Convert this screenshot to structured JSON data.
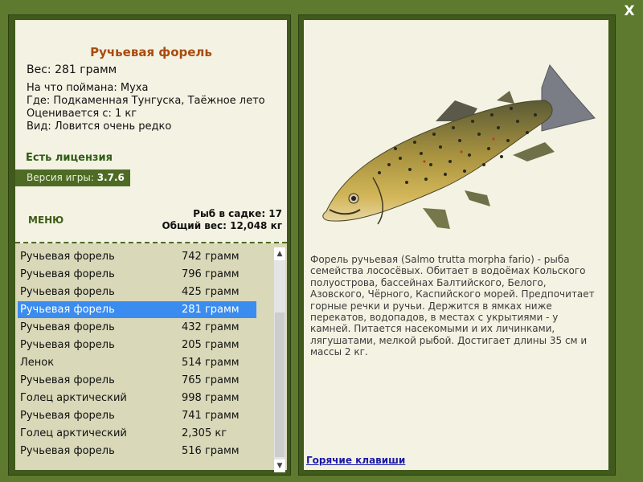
{
  "fish": {
    "title": "Ручьевая форель",
    "weight": "Вес: 281 грамм",
    "caught_on": "На что поймана: Муха",
    "location": "Где: Подкаменная Тунгуска, Таёжное лето",
    "valued_from": "Оценивается с: 1 кг",
    "rarity": "Вид: Ловится очень редко"
  },
  "license": "Есть лицензия",
  "version": {
    "label": "Версия игры: ",
    "value": "3.7.6"
  },
  "menu_label": "МЕНЮ",
  "stats": {
    "count": "Рыб в садке: 17",
    "total_weight": "Общий вес: 12,048 кг"
  },
  "catch_list": [
    {
      "name": "Ручьевая форель",
      "weight": "742 грамм"
    },
    {
      "name": "Ручьевая форель",
      "weight": "796 грамм"
    },
    {
      "name": "Ручьевая форель",
      "weight": "425 грамм"
    },
    {
      "name": "Ручьевая форель",
      "weight": "281 грамм",
      "selected": true
    },
    {
      "name": "Ручьевая форель",
      "weight": "432 грамм"
    },
    {
      "name": "Ручьевая форель",
      "weight": "205 грамм"
    },
    {
      "name": "Ленок",
      "weight": "514 грамм"
    },
    {
      "name": "Ручьевая форель",
      "weight": "765 грамм"
    },
    {
      "name": "Голец арктический",
      "weight": "998 грамм"
    },
    {
      "name": "Ручьевая форель",
      "weight": "741 грамм"
    },
    {
      "name": "Голец арктический",
      "weight": "2,305 кг"
    },
    {
      "name": "Ручьевая форель",
      "weight": "516 грамм"
    }
  ],
  "description": "Форель ручьевая (Salmo trutta morpha fario) - рыба семейства лососёвых. Обитает в водоёмах Кольского полуострова, бассейнах Балтийского, Белого, Азовского, Чёрного, Каспийского морей. Предпочитает горные речки и ручьи. Держится в ямках ниже перекатов, водопадов, в местах с укрытиями - у камней. Питается насекомыми и их личинками, лягушатами, мелкой рыбой. Достигает длины 35 см и массы 2 кг.",
  "hotkeys_label": "Горячие клавиши",
  "close_label": "X",
  "colors": {
    "frame": "#5d7a2e",
    "panel_bg": "#f4f2e2",
    "title": "#a94b10",
    "selection": "#3a8cf0",
    "list_bg": "#d9d8b9"
  }
}
